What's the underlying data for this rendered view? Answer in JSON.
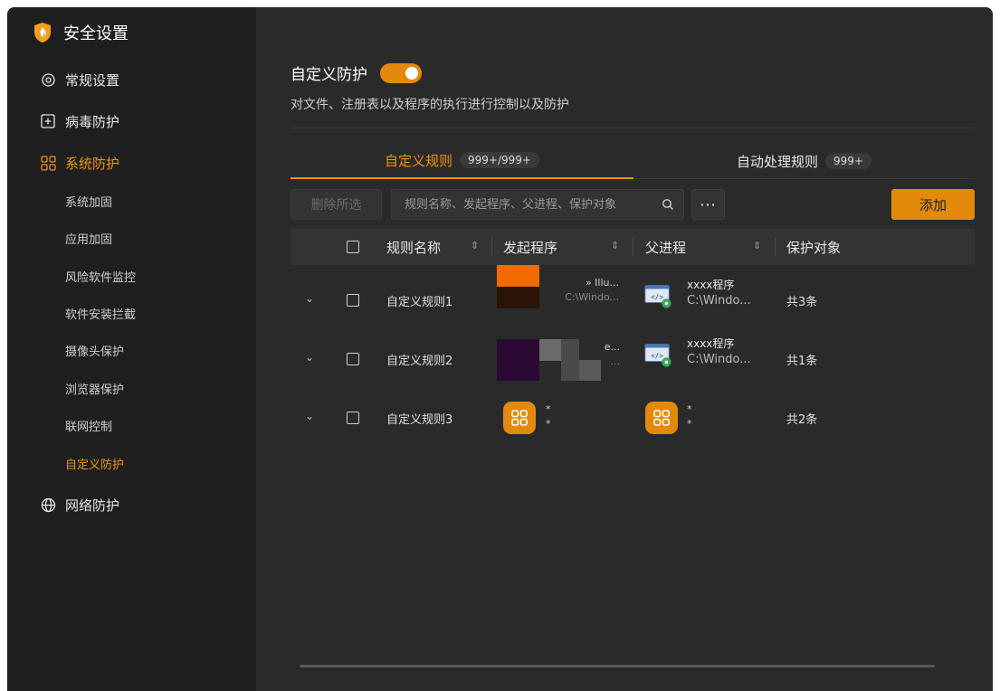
{
  "app": {
    "title": "安全设置"
  },
  "sidebar": {
    "items": [
      {
        "label": "常规设置",
        "icon": "gear-icon"
      },
      {
        "label": "病毒防护",
        "icon": "plus-square-icon"
      },
      {
        "label": "系统防护",
        "icon": "grid-icon"
      },
      {
        "label": "网络防护",
        "icon": "globe-icon"
      }
    ],
    "sub_items": [
      "系统加固",
      "应用加固",
      "风险软件监控",
      "软件安装拦截",
      "摄像头保护",
      "浏览器保护",
      "联网控制",
      "自定义防护"
    ]
  },
  "main": {
    "title": "自定义防护",
    "toggle_on": true,
    "subtitle": "对文件、注册表以及程序的执行进行控制以及防护"
  },
  "tabs": [
    {
      "label": "自定义规则",
      "badge": "999+/999+"
    },
    {
      "label": "自动处理规则",
      "badge": "999+"
    }
  ],
  "toolbar": {
    "delete_label": "删除所选",
    "search_placeholder": "规则名称、发起程序、父进程、保护对象",
    "more_label": "···",
    "add_label": "添加"
  },
  "table": {
    "headers": [
      "规则名称",
      "发起程序",
      "父进程",
      "保护对象"
    ],
    "sort_glyph": "⇕",
    "rows": [
      {
        "name": "自定义规则1",
        "initiator_text": "» Illu...",
        "initiator_sub": "C:\\Windo...",
        "parent_name": "xxxx程序",
        "parent_path": "C:\\Windo...",
        "protect": "共3条"
      },
      {
        "name": "自定义规则2",
        "initiator_text": "e...",
        "initiator_sub": "...",
        "parent_name": "xxxx程序",
        "parent_path": "C:\\Windo...",
        "protect": "共1条"
      },
      {
        "name": "自定义规则3",
        "initiator_text": "*",
        "initiator_sub": "*",
        "parent_name": "*",
        "parent_path": "*",
        "protect": "共2条"
      }
    ]
  },
  "colors": {
    "accent": "#e38a0c",
    "accent_text": "#f0940f",
    "bg": "#2a2a2a",
    "sidebar_bg": "#1f1f1f"
  }
}
